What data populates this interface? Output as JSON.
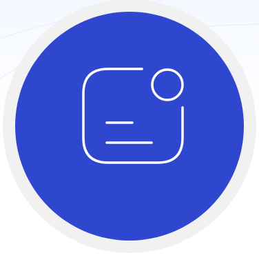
{
  "icon": {
    "name": "notification-message-icon",
    "badge_color": "#2f47cf",
    "ring_color": "#f1f1f2",
    "glyph_color": "#ffffff"
  },
  "background": {
    "tint": "#f4f8ff"
  }
}
